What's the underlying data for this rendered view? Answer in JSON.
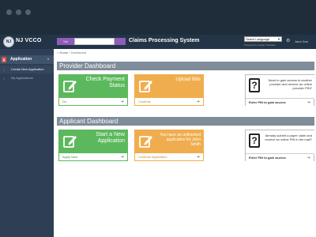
{
  "header": {
    "logo_text": "NJ",
    "brand": "NJ VCCO",
    "nav_tab": "Tab",
    "app_title": "Claims Processing System",
    "language_select": "Select Language",
    "powered_by": "Powered by Google Translate",
    "user": "Jane Doe"
  },
  "sidebar": {
    "section": "Application",
    "items": [
      {
        "label": "Create New Application"
      },
      {
        "label": "My Applications"
      }
    ]
  },
  "breadcrumb": {
    "home": "Home",
    "sep": "/",
    "current": "Dashboard"
  },
  "provider": {
    "title": "Provider Dashboard",
    "cards": [
      {
        "text": "Check Payment Status",
        "footer": "Go",
        "color": "#5cb85c"
      },
      {
        "text": "Upload Bills",
        "footer": "Continue",
        "color": "#f0ad4e"
      },
      {
        "text": "Need to gain access to another provider and receive an online provider PIN?",
        "footer": "Enter PIN to gain access"
      }
    ]
  },
  "applicant": {
    "title": "Applicant Dashboard",
    "cards": [
      {
        "text": "Start a New Application",
        "footer": "Apply Now",
        "color": "#5cb85c"
      },
      {
        "text": "You have an unfinished application for John Smith",
        "footer": "Continue Application",
        "color": "#f0ad4e"
      },
      {
        "text": "Already submit a paper claim and receive an online PIN in the mail?",
        "footer": "Enter PIN to gain access"
      }
    ]
  },
  "icons": {
    "edit": "edit-icon",
    "question": "question-icon",
    "arrow": "arrow-circle-icon",
    "gear": "gear-icon"
  }
}
